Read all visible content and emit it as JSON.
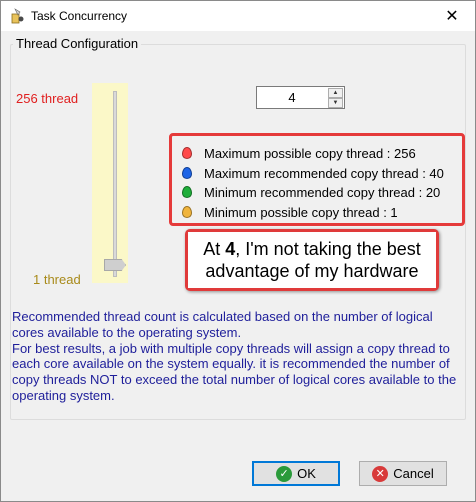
{
  "window": {
    "title": "Task Concurrency",
    "close_glyph": "✕"
  },
  "group": {
    "label": "Thread Configuration"
  },
  "slider": {
    "max_label": "256 thread",
    "min_label": "1 thread",
    "min": 1,
    "max": 256,
    "value": 4
  },
  "spinner": {
    "value": "4",
    "up_glyph": "▲",
    "down_glyph": "▼"
  },
  "legend": {
    "items": [
      {
        "label": "Maximum possible copy thread : 256",
        "color": "#ff4a4a",
        "icon": "red-marker-icon"
      },
      {
        "label": "Maximum recommended copy thread : 40",
        "color": "#1e64e6",
        "icon": "blue-marker-icon"
      },
      {
        "label": "Minimum recommended copy thread : 20",
        "color": "#1fae3a",
        "icon": "green-marker-icon"
      },
      {
        "label": "Minimum possible copy thread : 1",
        "color": "#f0b43c",
        "icon": "orange-marker-icon"
      }
    ]
  },
  "callout": {
    "prefix": "At ",
    "bold": "4",
    "suffix": ", I'm not taking the best advantage of my hardware"
  },
  "description": {
    "paragraph1": "Recommended thread count is calculated based on the number of logical cores available to the operating system.",
    "paragraph2": "For best results, a job with multiple copy threads will assign a copy thread to each core available on the system equally. it is recommended the number of copy threads NOT to exceed the total number of logical cores available to the operating system."
  },
  "buttons": {
    "ok_label": "OK",
    "cancel_label": "Cancel",
    "ok_icon": "check-icon",
    "cancel_icon": "cancel-icon"
  },
  "colors": {
    "accent_red": "#e53a3a",
    "description_text": "#1e1e9a",
    "slider_bg": "#fbf8c8"
  }
}
